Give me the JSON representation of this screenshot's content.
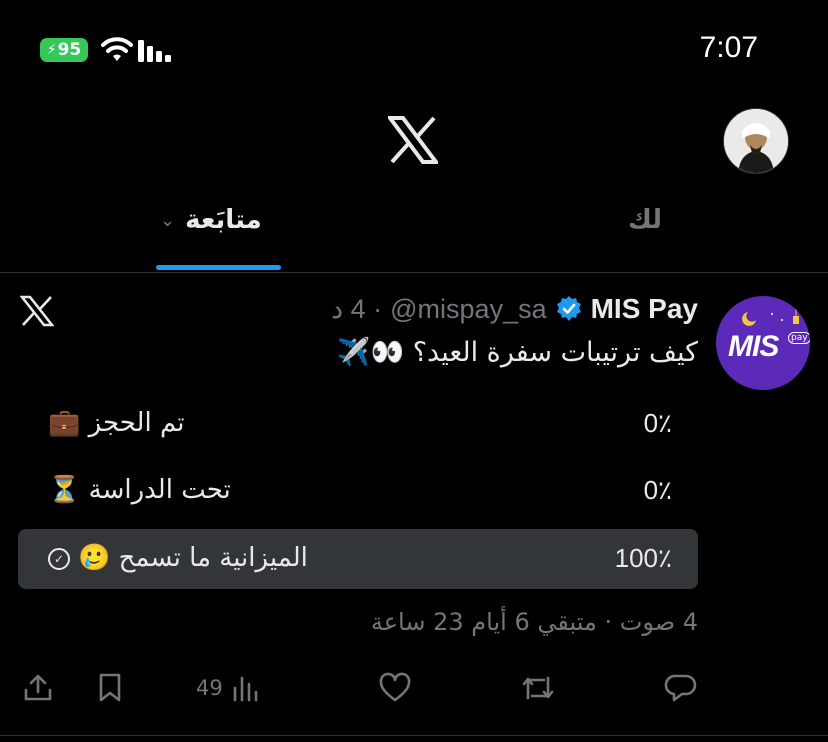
{
  "status_bar": {
    "battery": "95",
    "time": "7:07"
  },
  "tabs": {
    "following": "متابَعة",
    "for_you": "لك"
  },
  "tweet": {
    "display_name": "MIS Pay",
    "handle": "@mispay_sa",
    "time_ago": "· 4 د",
    "text": "كيف ترتيبات سفرة العيد؟ 👀✈️",
    "avatar_text": "MIS",
    "avatar_sub": "pay"
  },
  "poll": {
    "options": [
      {
        "label": "تم الحجز 💼",
        "percent": "0٪",
        "winner": false
      },
      {
        "label": "تحت الدراسة ⏳",
        "percent": "0٪",
        "winner": false
      },
      {
        "label": "الميزانية ما تسمح 🥲",
        "percent": "100٪",
        "winner": true
      }
    ],
    "meta": "4 صوت · متبقي 6 أيام 23 ساعة"
  },
  "actions": {
    "views": "49"
  },
  "colors": {
    "accent": "#1d9bf0",
    "battery": "#34c759",
    "brand": "#5b2ab8"
  }
}
